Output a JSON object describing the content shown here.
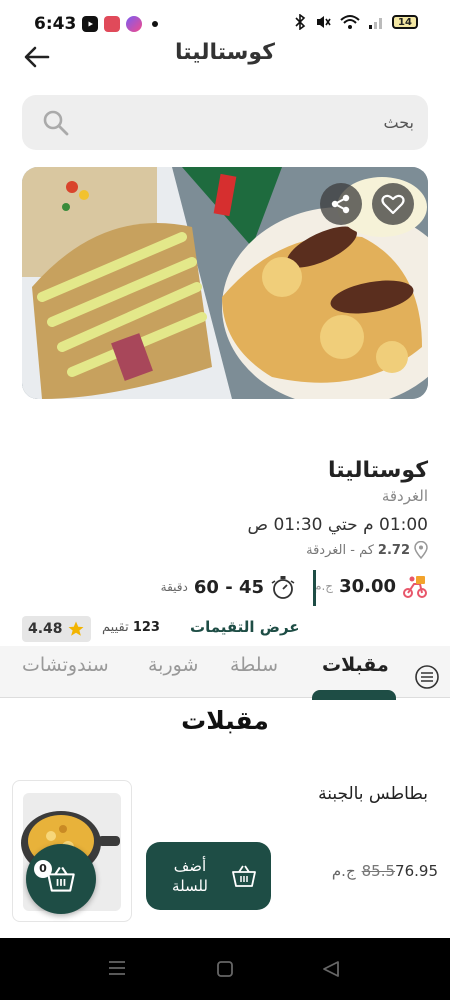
{
  "status_bar": {
    "time": "6:43",
    "battery": "14"
  },
  "header": {
    "title": "كوستاليتا"
  },
  "search": {
    "placeholder": "بحث"
  },
  "restaurant": {
    "name": "كوستاليتا",
    "city": "الغردقة",
    "hours": "01:00 م حتي 01:30 ص",
    "distance": "2.72",
    "distance_text": "كم - الغردقة",
    "delivery_fee": "30.00",
    "currency": "ج.م",
    "delivery_time": "45 - 60",
    "time_unit": "دقيقة",
    "rating": "4.48",
    "review_count": "123",
    "review_label": "تقييم",
    "reviews_link": "عرض التقيمات"
  },
  "tabs": [
    "مقبلات",
    "سلطة",
    "شوربة",
    "سندوتشات"
  ],
  "section": {
    "title": "مقبلات"
  },
  "product": {
    "name": "بطاطس بالجبنة",
    "price": "76.95",
    "old_price": "85.5",
    "currency": "ج.م",
    "add_label": "أضف للسلة"
  },
  "cart": {
    "count": "0"
  },
  "colors": {
    "brand": "#1e4d45",
    "star": "#f2b400"
  }
}
